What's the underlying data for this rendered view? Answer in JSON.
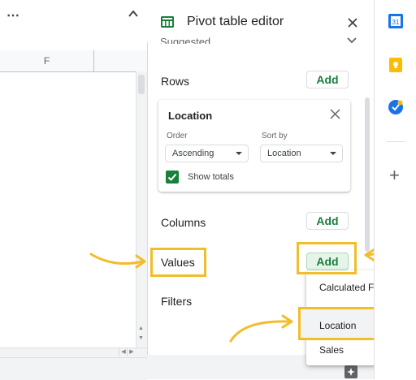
{
  "sheet": {
    "more_label": "⋯",
    "columns": [
      "F"
    ]
  },
  "editor": {
    "title": "Pivot table editor",
    "suggested_label": "Suggested",
    "rows_label": "Rows",
    "columns_label": "Columns",
    "values_label": "Values",
    "filters_label": "Filters",
    "add_label": "Add"
  },
  "location_card": {
    "title": "Location",
    "order_label": "Order",
    "order_value": "Ascending",
    "sortby_label": "Sort by",
    "sortby_value": "Location",
    "show_totals_label": "Show totals",
    "show_totals_checked": true
  },
  "values_menu": {
    "items": [
      "Calculated Field",
      "Location",
      "Sales"
    ],
    "hovered": "Location"
  },
  "side_bar": {
    "icons": [
      "calendar-icon",
      "keep-icon",
      "tasks-icon",
      "plus-icon"
    ]
  },
  "colors": {
    "accent_green": "#188038",
    "highlight_yellow": "#f2bd2a",
    "calendar_blue": "#1a73e8",
    "keep_yellow": "#fbbc04"
  }
}
